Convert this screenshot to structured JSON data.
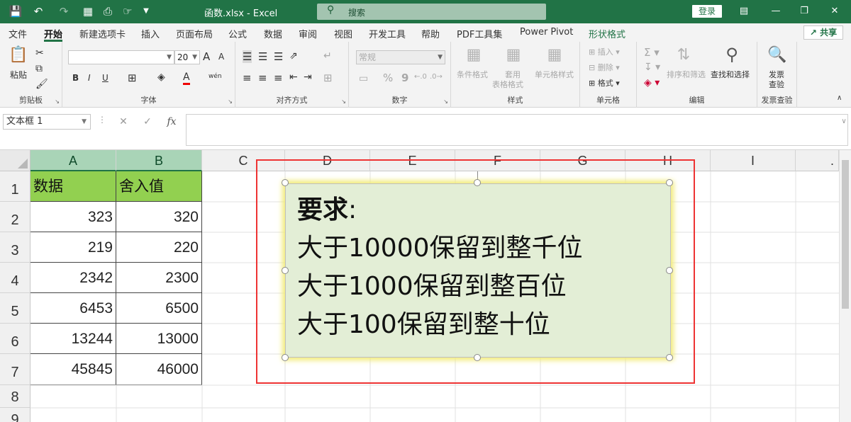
{
  "titlebar": {
    "doc_title": "函数.xlsx  -  Excel",
    "search_placeholder": "搜索",
    "login_label": "登录",
    "quick_access_icons": [
      "save-icon",
      "undo-icon",
      "redo-icon",
      "form-icon",
      "print-preview-icon",
      "touch-mode-icon",
      "customize-icon"
    ]
  },
  "tabs": [
    {
      "label": "文件"
    },
    {
      "label": "开始",
      "active": true
    },
    {
      "label": "新建选项卡"
    },
    {
      "label": "插入"
    },
    {
      "label": "页面布局"
    },
    {
      "label": "公式"
    },
    {
      "label": "数据"
    },
    {
      "label": "审阅"
    },
    {
      "label": "视图"
    },
    {
      "label": "开发工具"
    },
    {
      "label": "帮助"
    },
    {
      "label": "PDF工具集"
    },
    {
      "label": "Power Pivot"
    },
    {
      "label": "形状格式"
    }
  ],
  "share_label": "共享",
  "ribbon": {
    "clipboard": {
      "label": "剪贴板",
      "paste": "粘贴"
    },
    "font": {
      "label": "字体",
      "font_name": "",
      "font_size": "20",
      "bold": "B",
      "italic": "I",
      "underline": "U",
      "grow": "A",
      "shrink": "A",
      "color_a": "A",
      "wen": "wén"
    },
    "alignment": {
      "label": "对齐方式"
    },
    "number": {
      "label": "数字",
      "format": "常规",
      "percent": "%",
      "comma": "9"
    },
    "styles": {
      "label": "样式",
      "cond": "条件格式",
      "table_1": "套用",
      "table_2": "表格格式",
      "cell_style": "单元格样式"
    },
    "cells": {
      "label": "单元格",
      "insert": "插入",
      "delete": "删除",
      "format": "格式"
    },
    "editing": {
      "label": "编辑",
      "sort": "排序和筛选",
      "find": "查找和选择"
    },
    "invoice": {
      "label": "发票查验",
      "btn_1": "发票",
      "btn_2": "查验"
    }
  },
  "formula_bar": {
    "name_box": "文本框 1",
    "fx": "fx",
    "value": ""
  },
  "sheet": {
    "columns": [
      "A",
      "B",
      "C",
      "D",
      "E",
      "F",
      "G",
      "H",
      "I",
      "."
    ],
    "rows": [
      "1",
      "2",
      "3",
      "4",
      "5",
      "6",
      "7",
      "8",
      "9"
    ],
    "header": [
      "数据",
      "舍入值"
    ],
    "data": [
      [
        "323",
        "320"
      ],
      [
        "219",
        "220"
      ],
      [
        "2342",
        "2300"
      ],
      [
        "6453",
        "6500"
      ],
      [
        "13244",
        "13000"
      ],
      [
        "45845",
        "46000"
      ]
    ]
  },
  "textbox": {
    "title": "要求",
    "colon": ":",
    "lines": [
      "大于10000保留到整千位",
      "大于1000保留到整百位",
      "大于100保留到整十位"
    ]
  },
  "colors": {
    "excel_green": "#217346",
    "header_fill": "#92d050",
    "textbox_fill": "#e3eed6",
    "frame_red": "#ee3333"
  }
}
